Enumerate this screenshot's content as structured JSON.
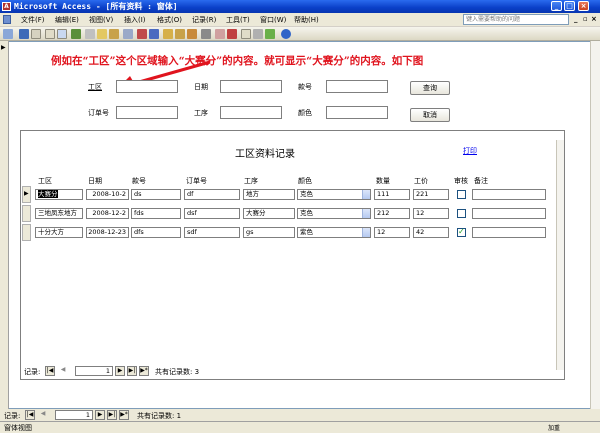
{
  "window": {
    "title": "Microsoft Access - [所有资料 : 窗体]"
  },
  "menu": {
    "items": [
      "文件(F)",
      "编辑(E)",
      "视图(V)",
      "插入(I)",
      "格式(O)",
      "记录(R)",
      "工具(T)",
      "窗口(W)",
      "帮助(H)"
    ],
    "help_placeholder": "键入需要帮助的问题"
  },
  "annotation": "例如在“工区”这个区域输入“大赛分”的内容。就可显示“大赛分”的内容。如下图",
  "search": {
    "labels": {
      "gongqu": "工区",
      "riqi": "日期",
      "kuanhao": "款号",
      "dingdanhao": "订单号",
      "gongxu": "工序",
      "yanse": "颜色"
    },
    "query_button": "查询",
    "cancel_button": "取消"
  },
  "subform": {
    "title": "工区资料记录",
    "print_link": "打印",
    "columns": [
      "工区",
      "日期",
      "款号",
      "订单号",
      "工序",
      "颜色",
      "数量",
      "工价",
      "审核",
      "备注"
    ],
    "rows": [
      {
        "gongqu": "大赛分",
        "riqi": "2008-10-2",
        "kuanhao": "ds",
        "dingdanhao": "df",
        "gongxu": "地方",
        "yanse": "克色",
        "shuliang": "111",
        "gongjia": "221",
        "shenhe": false,
        "beizhu": ""
      },
      {
        "gongqu": "三地凤东地方",
        "riqi": "2008-12-2",
        "kuanhao": "fds",
        "dingdanhao": "dsf",
        "gongxu": "大赛分",
        "yanse": "克色",
        "shuliang": "212",
        "gongjia": "12",
        "shenhe": false,
        "beizhu": ""
      },
      {
        "gongqu": "十分大方",
        "riqi": "2008-12-23",
        "kuanhao": "dfs",
        "dingdanhao": "sdf",
        "gongxu": "gs",
        "yanse": "紫色",
        "shuliang": "12",
        "gongjia": "42",
        "shenhe": true,
        "beizhu": ""
      }
    ],
    "nav": {
      "label": "记录:",
      "current": "1",
      "total_text": "共有记录数: 3"
    }
  },
  "main_nav": {
    "label": "记录:",
    "current": "1",
    "total_text": "共有记录数: 1"
  },
  "status": {
    "left": "窗体视图",
    "right": "加重"
  },
  "colors": {
    "annotation": "#e0141e",
    "titlebar": "#0a3fc8",
    "link": "#0000ee"
  }
}
